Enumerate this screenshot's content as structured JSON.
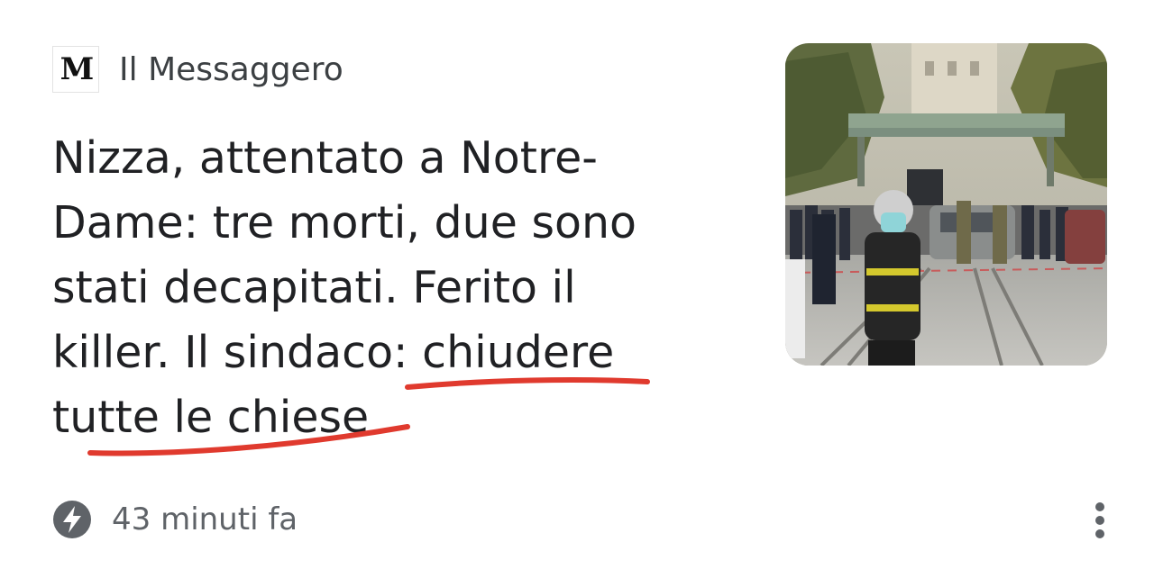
{
  "article": {
    "publisher": {
      "logo_glyph": "M",
      "name": "Il Messaggero"
    },
    "headline_lines": [
      "Nizza, attentato a Notre-",
      "Dame: tre morti, due sono",
      "stati decapitati. Ferito il",
      "killer. Il sindaco: chiudere",
      "tutte le chiese"
    ],
    "timestamp": "43 minuti fa",
    "icons": {
      "amp": "lightning-bolt-icon",
      "more": "more-vert-icon"
    },
    "colors": {
      "annotation": "#e03a2e",
      "headline": "#202124",
      "meta": "#5f6368"
    }
  }
}
